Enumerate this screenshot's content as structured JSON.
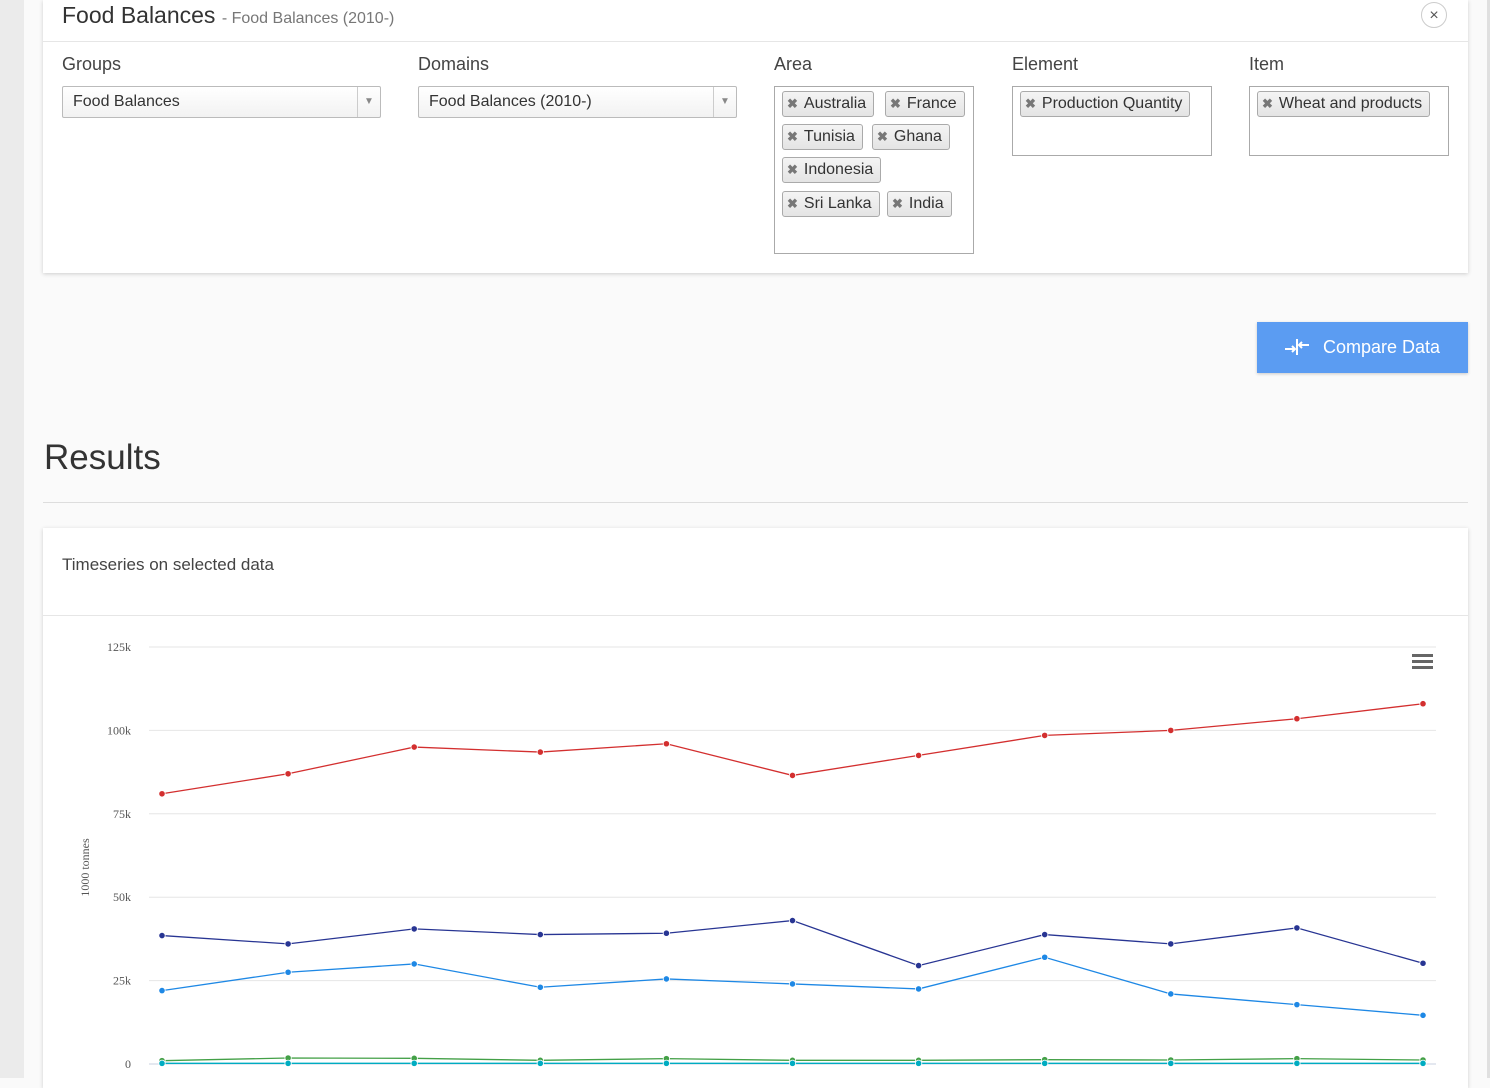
{
  "panel": {
    "title": "Food Balances",
    "subtitle": "- Food Balances (2010-)",
    "close_label": "×"
  },
  "filters": {
    "groups": {
      "label": "Groups",
      "value": "Food Balances"
    },
    "domains": {
      "label": "Domains",
      "value": "Food Balances (2010-)"
    },
    "area": {
      "label": "Area",
      "tags": [
        "Australia",
        "France",
        "Tunisia",
        "Ghana",
        "Indonesia",
        "Sri Lanka",
        "India"
      ]
    },
    "element": {
      "label": "Element",
      "tags": [
        "Production Quantity"
      ]
    },
    "item": {
      "label": "Item",
      "tags": [
        "Wheat and products"
      ]
    }
  },
  "compare_button": {
    "label": "Compare Data",
    "icon": "compare-arrows-icon"
  },
  "results": {
    "title": "Results"
  },
  "chart_card": {
    "title": "Timeseries on selected data",
    "menu_icon": "hamburger-menu-icon"
  },
  "chart_data": {
    "type": "line",
    "ylabel": "1000 tonnes",
    "ylim": [
      0,
      125000
    ],
    "yticks": [
      0,
      25000,
      50000,
      75000,
      100000,
      125000
    ],
    "ytick_labels": [
      "0",
      "25k",
      "50k",
      "75k",
      "100k",
      "125k"
    ],
    "grid": true,
    "series": [
      {
        "color": "#d32f2f",
        "values": [
          81000,
          87000,
          95000,
          93500,
          96000,
          86500,
          92500,
          98500,
          100000,
          103500,
          108000
        ]
      },
      {
        "color": "#283593",
        "values": [
          38500,
          36000,
          40500,
          38800,
          39200,
          43000,
          29500,
          38800,
          36000,
          40800,
          30200
        ]
      },
      {
        "color": "#1e88e5",
        "values": [
          22000,
          27500,
          30000,
          23000,
          25500,
          24000,
          22500,
          32000,
          21000,
          17800,
          14600
        ]
      },
      {
        "color": "#43a047",
        "values": [
          1000,
          1800,
          1700,
          1100,
          1600,
          1100,
          1100,
          1300,
          1200,
          1600,
          1200
        ]
      },
      {
        "color": "#00acc1",
        "values": [
          200,
          200,
          200,
          200,
          200,
          200,
          200,
          200,
          200,
          200,
          200
        ]
      }
    ]
  }
}
